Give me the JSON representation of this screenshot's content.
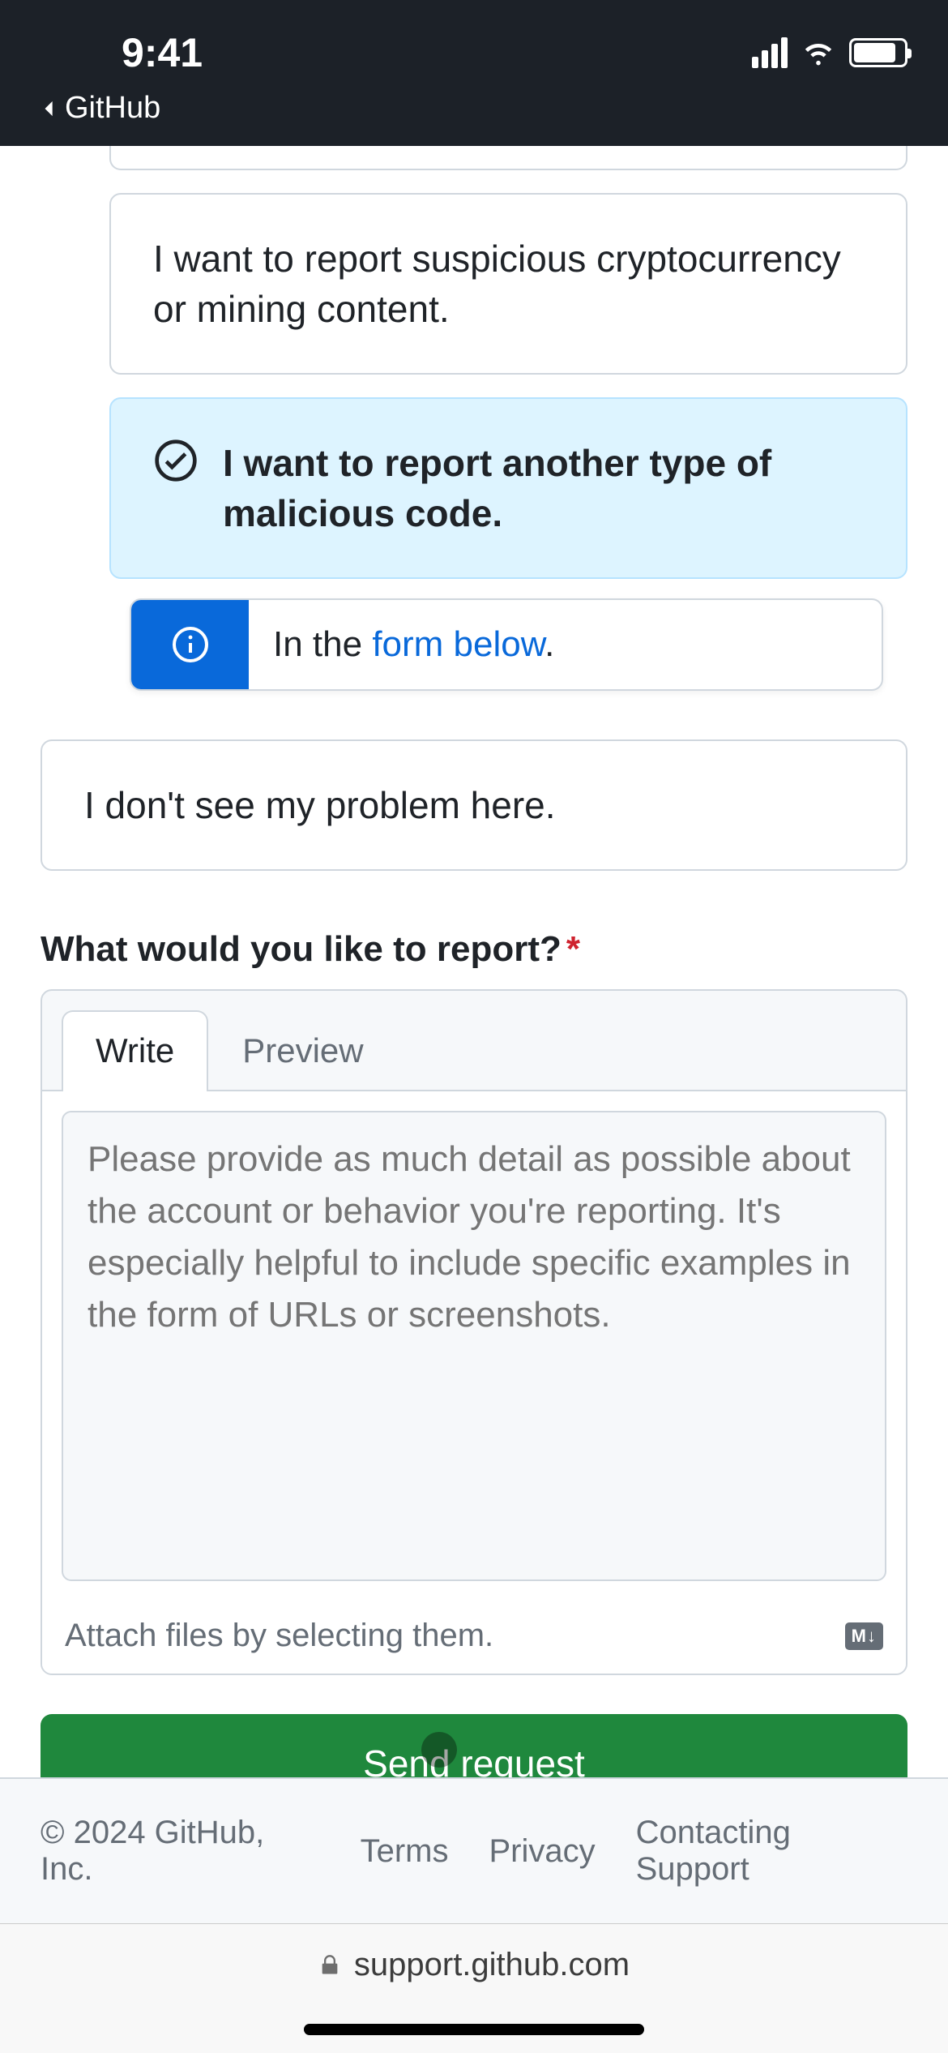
{
  "status": {
    "time": "9:41",
    "back_app": "GitHub"
  },
  "options": {
    "crypto": "I want to report suspicious cryptocurrency or mining content.",
    "malicious": "I want to report another type of malicious code.",
    "not_found": "I don't see my problem here."
  },
  "callout": {
    "prefix": "In the ",
    "link": "form below",
    "suffix": "."
  },
  "form": {
    "label": "What would you like to report?",
    "tabs": {
      "write": "Write",
      "preview": "Preview"
    },
    "placeholder": "Please provide as much detail as possible about the account or behavior you're reporting. It's especially helpful to include specific examples in the form of URLs or screenshots.",
    "attach_hint": "Attach files by selecting them.",
    "md_badge": "M↓",
    "submit": "Send request"
  },
  "footer": {
    "copyright": "© 2024 GitHub, Inc.",
    "terms": "Terms",
    "privacy": "Privacy",
    "contact": "Contacting Support"
  },
  "browser": {
    "url": "support.github.com"
  }
}
